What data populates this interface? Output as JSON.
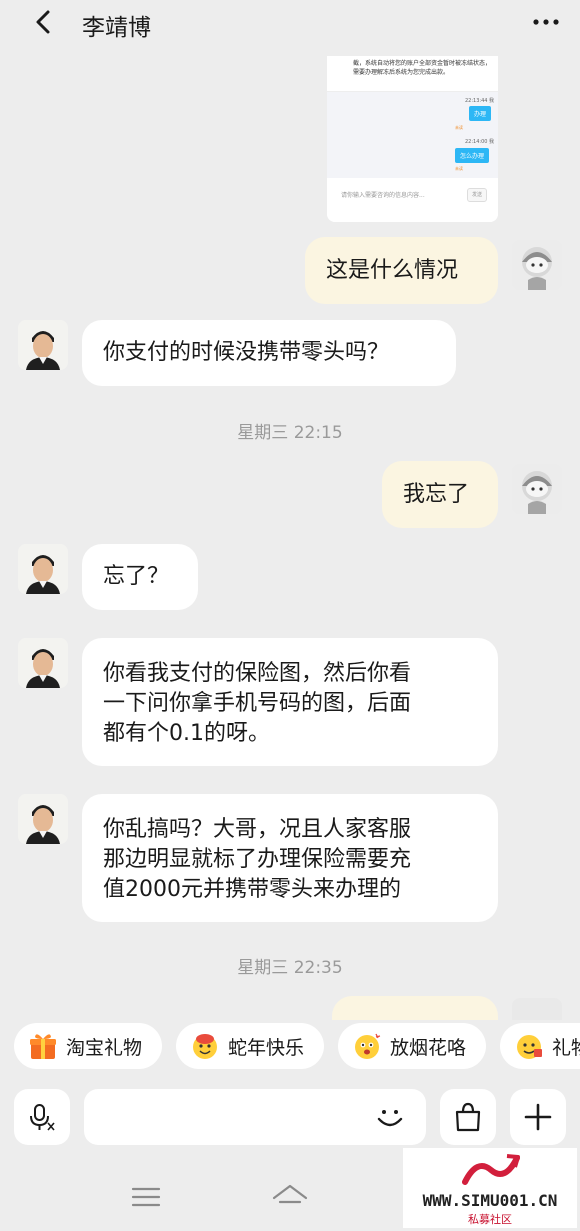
{
  "header": {
    "title": "李靖博",
    "back_icon": "chevron-left-icon",
    "more_icon": "ellipsis-icon"
  },
  "screenshot": {
    "notice": "截，系统自动将您的账户全部资金暂时被冻结状态，需要办理解冻后系统为您完成出款。",
    "time1": "22:13:44 我",
    "button1": "办理",
    "tag1": "未读",
    "time2": "22:14:00 我",
    "button2": "怎么办理",
    "tag2": "未读",
    "placeholder": "请你输入需要咨询的信息内容...",
    "send": "发送"
  },
  "messages": [
    {
      "from": "me",
      "text": "这是什么情况"
    },
    {
      "from": "them",
      "text": "你支付的时候没携带零头吗？"
    },
    {
      "type": "time",
      "text": "星期三 22:15"
    },
    {
      "from": "me",
      "text": "我忘了"
    },
    {
      "from": "them",
      "text": "忘了？"
    },
    {
      "from": "them",
      "lines": [
        "你看我支付的保险图，然后你看",
        "一下问你拿手机号码的图，后面",
        "都有个0.1的呀。"
      ]
    },
    {
      "from": "them",
      "lines": [
        "你乱搞吗？大哥，况且人家客服",
        "那边明显就标了办理保险需要充",
        "值2000元并携带零头来办理的"
      ]
    },
    {
      "type": "time",
      "text": "星期三 22:35"
    }
  ],
  "chips": [
    {
      "label": "淘宝礼物",
      "icon": "gift-icon"
    },
    {
      "label": "蛇年快乐",
      "icon": "snake-face-icon"
    },
    {
      "label": "放烟花咯",
      "icon": "firework-face-icon"
    },
    {
      "label": "礼物",
      "icon": "gift-face-icon"
    }
  ],
  "input": {
    "placeholder": "",
    "voice_icon": "voice-input-icon",
    "emoji_icon": "smile-icon",
    "shop_icon": "shopping-bag-icon",
    "add_icon": "plus-icon"
  },
  "navbar": {
    "menu_icon": "menu-icon",
    "home_icon": "home-icon"
  },
  "watermark": {
    "site": "WWW.SIMU001.CN",
    "sub": "私募社区"
  },
  "colors": {
    "background": "#ededed",
    "my_bubble": "#fbf5e1",
    "their_bubble": "#ffffff",
    "accent_blue": "#2db7f5",
    "watermark_red": "#c8102e"
  }
}
